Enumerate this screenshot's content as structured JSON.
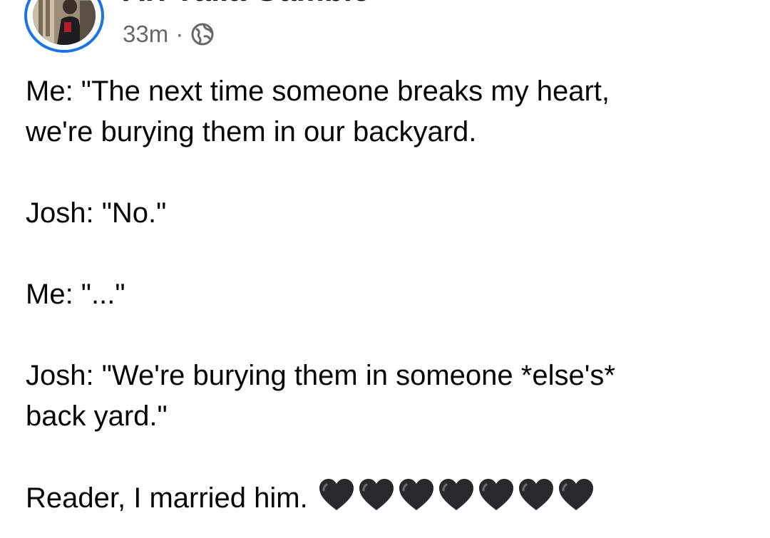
{
  "post": {
    "author": "Ari Yalla Gamble",
    "timestamp": "33m",
    "separator": "·",
    "audience_icon": "globe-icon",
    "avatar_ring_color": "#1b74e4",
    "paragraphs": [
      {
        "line1": "Me: \"The next time someone breaks my heart,",
        "line2": "we're burying them in our backyard."
      },
      {
        "line1": "Josh: \"No.\""
      },
      {
        "line1": "Me: \"...\""
      },
      {
        "line1": "Josh: \"We're burying them in someone *else's*",
        "line2": "back yard.\""
      },
      {
        "line1": "Reader, I married him."
      }
    ],
    "hearts": {
      "icon": "black-heart-icon",
      "count": 7,
      "color": "#2a2a2e"
    }
  }
}
